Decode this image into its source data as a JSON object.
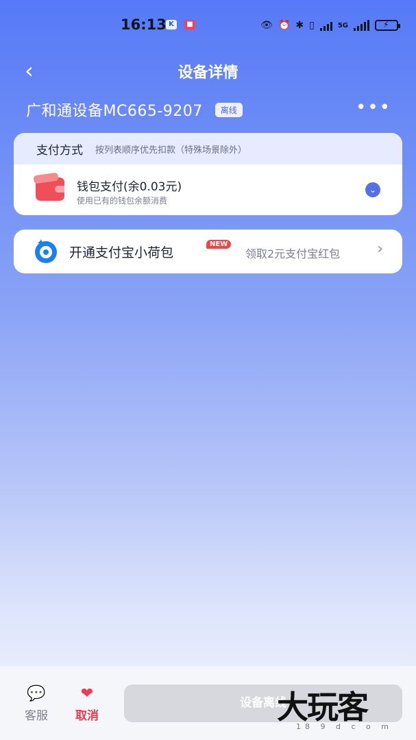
{
  "status_bar": {
    "time": "16:13",
    "app_icons": [
      "K",
      "■"
    ],
    "network": "5G"
  },
  "header": {
    "title": "设备详情",
    "back_icon": "chevron-left-icon",
    "more_icon": "more-horizontal-icon"
  },
  "device": {
    "name": "广和通设备MC665-9207",
    "status": "离线"
  },
  "payment": {
    "section_title": "支付方式",
    "section_hint": "按列表顺序优先扣款（特殊场景除外）",
    "method": {
      "name": "钱包支付(余0.03元)",
      "description": "使用已有的钱包余额消费",
      "selected": true
    }
  },
  "alipay": {
    "title": "开通支付宝小荷包",
    "badge": "NEW",
    "promo": "领取2元支付宝红包"
  },
  "bottom_bar": {
    "service_label": "客服",
    "cancel_label": "取消",
    "action_button": "设备离线"
  },
  "watermark": {
    "text": "大玩客",
    "sub": "18 9 d c o m"
  },
  "colors": {
    "accent": "#5671e6",
    "danger": "#ef3a4f",
    "alipay": "#1b7ff0"
  }
}
